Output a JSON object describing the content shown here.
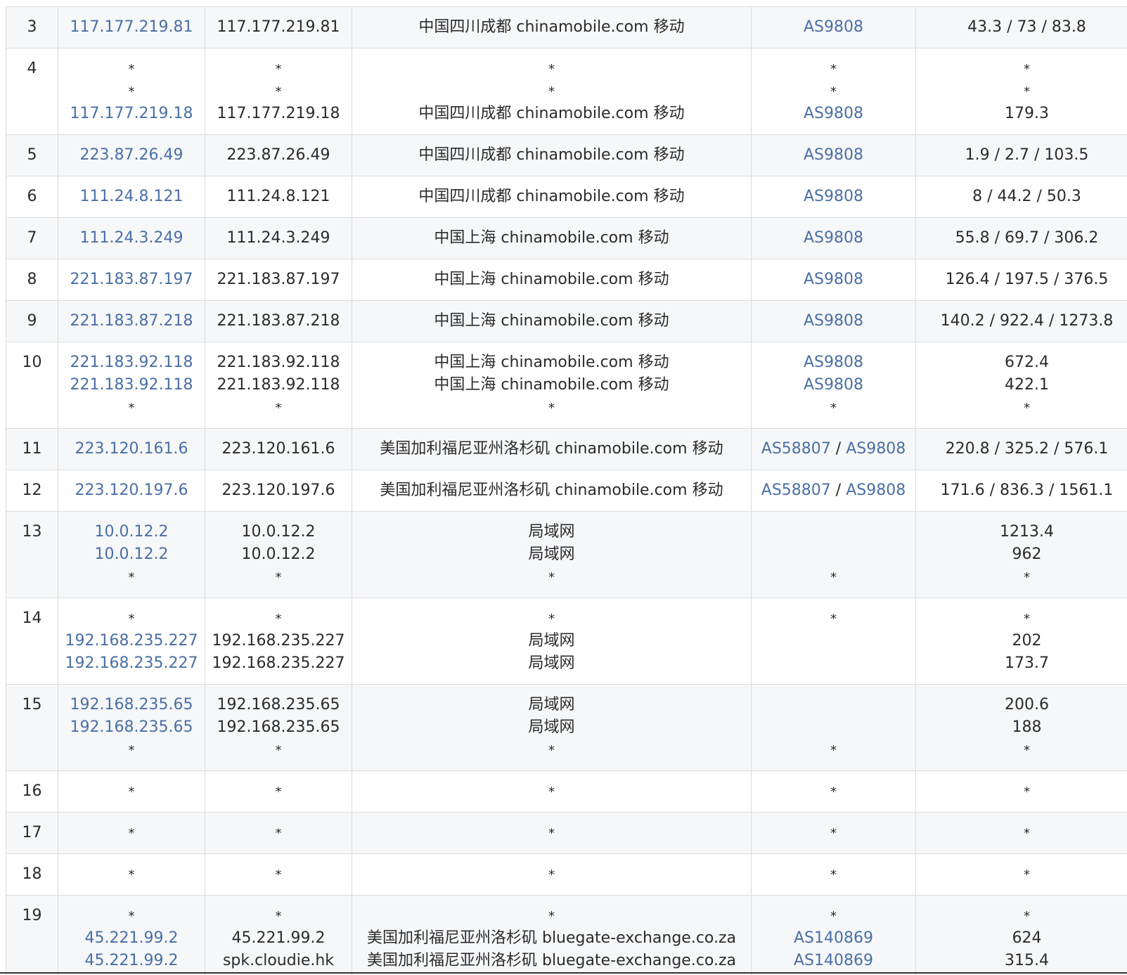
{
  "rows": [
    {
      "hop": "3",
      "ip": [
        "117.177.219.81"
      ],
      "host": [
        "117.177.219.81"
      ],
      "loc": [
        "中国四川成都 chinamobile.com 移动"
      ],
      "asn": [
        "AS9808"
      ],
      "rtt": [
        "43.3 / 73 / 83.8"
      ]
    },
    {
      "hop": "4",
      "ip": [
        "*",
        "*",
        "117.177.219.18"
      ],
      "host": [
        "*",
        "*",
        "117.177.219.18"
      ],
      "loc": [
        "*",
        "*",
        "中国四川成都 chinamobile.com 移动"
      ],
      "asn": [
        "*",
        "*",
        "AS9808"
      ],
      "rtt": [
        "*",
        "*",
        "179.3"
      ]
    },
    {
      "hop": "5",
      "ip": [
        "223.87.26.49"
      ],
      "host": [
        "223.87.26.49"
      ],
      "loc": [
        "中国四川成都 chinamobile.com 移动"
      ],
      "asn": [
        "AS9808"
      ],
      "rtt": [
        "1.9 / 2.7 / 103.5"
      ]
    },
    {
      "hop": "6",
      "ip": [
        "111.24.8.121"
      ],
      "host": [
        "111.24.8.121"
      ],
      "loc": [
        "中国四川成都 chinamobile.com 移动"
      ],
      "asn": [
        "AS9808"
      ],
      "rtt": [
        "8 / 44.2 / 50.3"
      ]
    },
    {
      "hop": "7",
      "ip": [
        "111.24.3.249"
      ],
      "host": [
        "111.24.3.249"
      ],
      "loc": [
        "中国上海 chinamobile.com 移动"
      ],
      "asn": [
        "AS9808"
      ],
      "rtt": [
        "55.8 / 69.7 / 306.2"
      ]
    },
    {
      "hop": "8",
      "ip": [
        "221.183.87.197"
      ],
      "host": [
        "221.183.87.197"
      ],
      "loc": [
        "中国上海 chinamobile.com 移动"
      ],
      "asn": [
        "AS9808"
      ],
      "rtt": [
        "126.4 / 197.5 / 376.5"
      ]
    },
    {
      "hop": "9",
      "ip": [
        "221.183.87.218"
      ],
      "host": [
        "221.183.87.218"
      ],
      "loc": [
        "中国上海 chinamobile.com 移动"
      ],
      "asn": [
        "AS9808"
      ],
      "rtt": [
        "140.2 / 922.4 / 1273.8"
      ]
    },
    {
      "hop": "10",
      "ip": [
        "221.183.92.118",
        "221.183.92.118",
        "*"
      ],
      "host": [
        "221.183.92.118",
        "221.183.92.118",
        "*"
      ],
      "loc": [
        "中国上海 chinamobile.com 移动",
        "中国上海 chinamobile.com 移动",
        "*"
      ],
      "asn": [
        "AS9808",
        "AS9808",
        "*"
      ],
      "rtt": [
        "672.4",
        "422.1",
        "*"
      ]
    },
    {
      "hop": "11",
      "ip": [
        "223.120.161.6"
      ],
      "host": [
        "223.120.161.6"
      ],
      "loc": [
        "美国加利福尼亚州洛杉矶 chinamobile.com 移动"
      ],
      "asn": [
        "AS58807 / AS9808"
      ],
      "rtt": [
        "220.8 / 325.2 / 576.1"
      ]
    },
    {
      "hop": "12",
      "ip": [
        "223.120.197.6"
      ],
      "host": [
        "223.120.197.6"
      ],
      "loc": [
        "美国加利福尼亚州洛杉矶 chinamobile.com 移动"
      ],
      "asn": [
        "AS58807 / AS9808"
      ],
      "rtt": [
        "171.6 / 836.3 / 1561.1"
      ]
    },
    {
      "hop": "13",
      "ip": [
        "10.0.12.2",
        "10.0.12.2",
        "*"
      ],
      "host": [
        "10.0.12.2",
        "10.0.12.2",
        "*"
      ],
      "loc": [
        "局域网",
        "局域网",
        "*"
      ],
      "asn": [
        "",
        "",
        "*"
      ],
      "rtt": [
        "1213.4",
        "962",
        "*"
      ]
    },
    {
      "hop": "14",
      "ip": [
        "*",
        "192.168.235.227",
        "192.168.235.227"
      ],
      "host": [
        "*",
        "192.168.235.227",
        "192.168.235.227"
      ],
      "loc": [
        "*",
        "局域网",
        "局域网"
      ],
      "asn": [
        "*",
        "",
        ""
      ],
      "rtt": [
        "*",
        "202",
        "173.7"
      ]
    },
    {
      "hop": "15",
      "ip": [
        "192.168.235.65",
        "192.168.235.65",
        "*"
      ],
      "host": [
        "192.168.235.65",
        "192.168.235.65",
        "*"
      ],
      "loc": [
        "局域网",
        "局域网",
        "*"
      ],
      "asn": [
        "",
        "",
        "*"
      ],
      "rtt": [
        "200.6",
        "188",
        "*"
      ]
    },
    {
      "hop": "16",
      "ip": [
        "*"
      ],
      "host": [
        "*"
      ],
      "loc": [
        "*"
      ],
      "asn": [
        "*"
      ],
      "rtt": [
        "*"
      ]
    },
    {
      "hop": "17",
      "ip": [
        "*"
      ],
      "host": [
        "*"
      ],
      "loc": [
        "*"
      ],
      "asn": [
        "*"
      ],
      "rtt": [
        "*"
      ]
    },
    {
      "hop": "18",
      "ip": [
        "*"
      ],
      "host": [
        "*"
      ],
      "loc": [
        "*"
      ],
      "asn": [
        "*"
      ],
      "rtt": [
        "*"
      ]
    },
    {
      "hop": "19",
      "ip": [
        "*",
        "45.221.99.2",
        "45.221.99.2"
      ],
      "host": [
        "*",
        "45.221.99.2",
        "spk.cloudie.hk"
      ],
      "loc": [
        "*",
        "美国加利福尼亚州洛杉矶 bluegate-exchange.co.za",
        "美国加利福尼亚州洛杉矶 bluegate-exchange.co.za"
      ],
      "asn": [
        "*",
        "AS140869",
        "AS140869"
      ],
      "rtt": [
        "*",
        "624",
        "315.4"
      ]
    }
  ]
}
